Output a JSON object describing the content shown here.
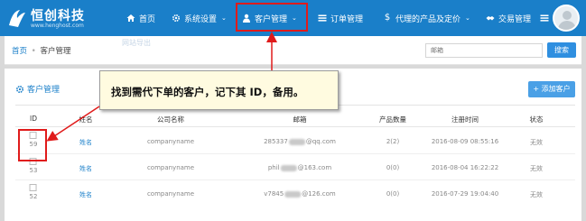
{
  "brand": {
    "name": "恒创科技",
    "sub": "www.henghost.com"
  },
  "nav": [
    {
      "label": "首页",
      "icon": "home-icon",
      "caret": false
    },
    {
      "label": "系统设置",
      "icon": "gear-icon",
      "caret": true
    },
    {
      "label": "客户管理",
      "icon": "user-icon",
      "caret": true,
      "active": true
    },
    {
      "label": "订单管理",
      "icon": "list-icon",
      "caret": false
    },
    {
      "label": "代理的产品及定价",
      "icon": "dollar-icon",
      "caret": true
    },
    {
      "label": "交易管理",
      "icon": "handshake-icon",
      "caret": false
    }
  ],
  "breadcrumb": {
    "home": "首页",
    "separator": "•",
    "current": "客户管理"
  },
  "ghost_tag": "网站导出",
  "search": {
    "placeholder": "邮箱",
    "button": "搜索"
  },
  "panel": {
    "title": "客户管理",
    "add_button": "+ 添加客户"
  },
  "table": {
    "headers": [
      "ID",
      "姓名",
      "公司名称",
      "邮箱",
      "产品数量",
      "注册时间",
      "状态"
    ],
    "rows": [
      {
        "id": "59",
        "name": "姓名",
        "company": "companyname",
        "email_prefix": "285337",
        "email_suffix": "@qq.com",
        "products": "2(2)",
        "registered": "2016-08-09 08:55:16",
        "status": "无效"
      },
      {
        "id": "53",
        "name": "姓名",
        "company": "companyname",
        "email_prefix": "phil",
        "email_suffix": "@163.com",
        "products": "0(0)",
        "registered": "2016-08-04 16:22:22",
        "status": "无效"
      },
      {
        "id": "52",
        "name": "姓名",
        "company": "companyname",
        "email_prefix": "v7845",
        "email_suffix": "@126.com",
        "products": "0(0)",
        "registered": "2016-07-29 19:04:40",
        "status": "无效"
      }
    ]
  },
  "callout": {
    "text": "找到需代下单的客户，记下其 ID，备用。"
  },
  "colors": {
    "header": "#1a7fc9",
    "accent": "#2f8fe0",
    "annotation": "#e01b1b",
    "callout_bg": "#fffbe0"
  }
}
